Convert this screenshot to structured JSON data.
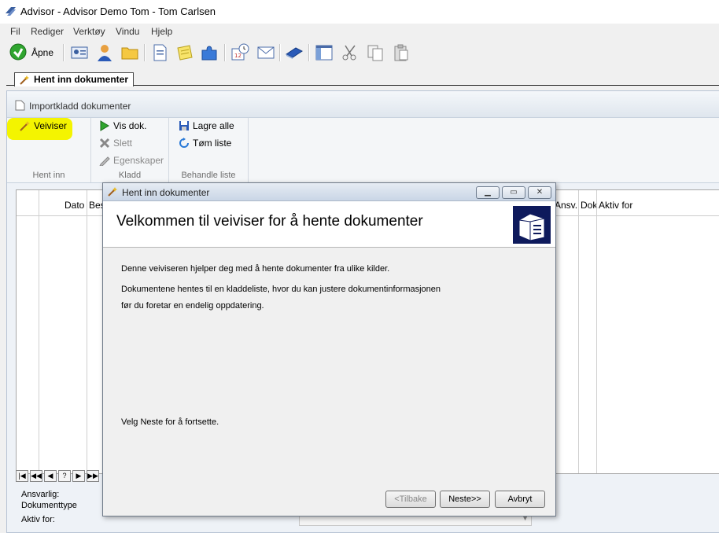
{
  "window": {
    "title": "Advisor - Advisor Demo Tom - Tom Carlsen"
  },
  "menu": [
    "Fil",
    "Rediger",
    "Verktøy",
    "Vindu",
    "Hjelp"
  ],
  "toolbar": {
    "open_label": "Åpne"
  },
  "tab": {
    "label": "Hent inn dokumenter"
  },
  "panel": {
    "title": "Importkladd dokumenter",
    "groups": [
      {
        "label": "Hent inn",
        "items": [
          "Veiviser"
        ]
      },
      {
        "label": "Kladd",
        "items": [
          "Vis dok.",
          "Slett",
          "Egenskaper"
        ]
      },
      {
        "label": "Behandle liste",
        "items": [
          "Lagre alle",
          "Tøm liste"
        ]
      }
    ]
  },
  "grid": {
    "headers": [
      "Dato",
      "Bes",
      "Ansv.",
      "Dok",
      "Aktiv for"
    ]
  },
  "nav": [
    "|◀",
    "◀◀",
    "◀",
    "?",
    "▶",
    "▶▶"
  ],
  "footer": {
    "ansvarlig": "Ansvarlig:",
    "dokumenttype": "Dokumenttype",
    "aktiv_for": "Aktiv for:"
  },
  "dialog": {
    "title": "Hent inn dokumenter",
    "heading": "Velkommen til veiviser for å hente dokumenter",
    "line1": "Denne veiviseren hjelper deg med å hente dokumenter fra ulike kilder.",
    "line2": "Dokumentene hentes til en kladdeliste, hvor du kan justere dokumentinformasjonen",
    "line3": "før du foretar en endelig oppdatering.",
    "line4": "Velg Neste for å fortsette.",
    "buttons": {
      "back": "<Tilbake",
      "next": "Neste>>",
      "cancel": "Avbryt"
    }
  },
  "colors": {
    "highlight": "#f4f400",
    "dialog_logo": "#0e1a5c"
  }
}
